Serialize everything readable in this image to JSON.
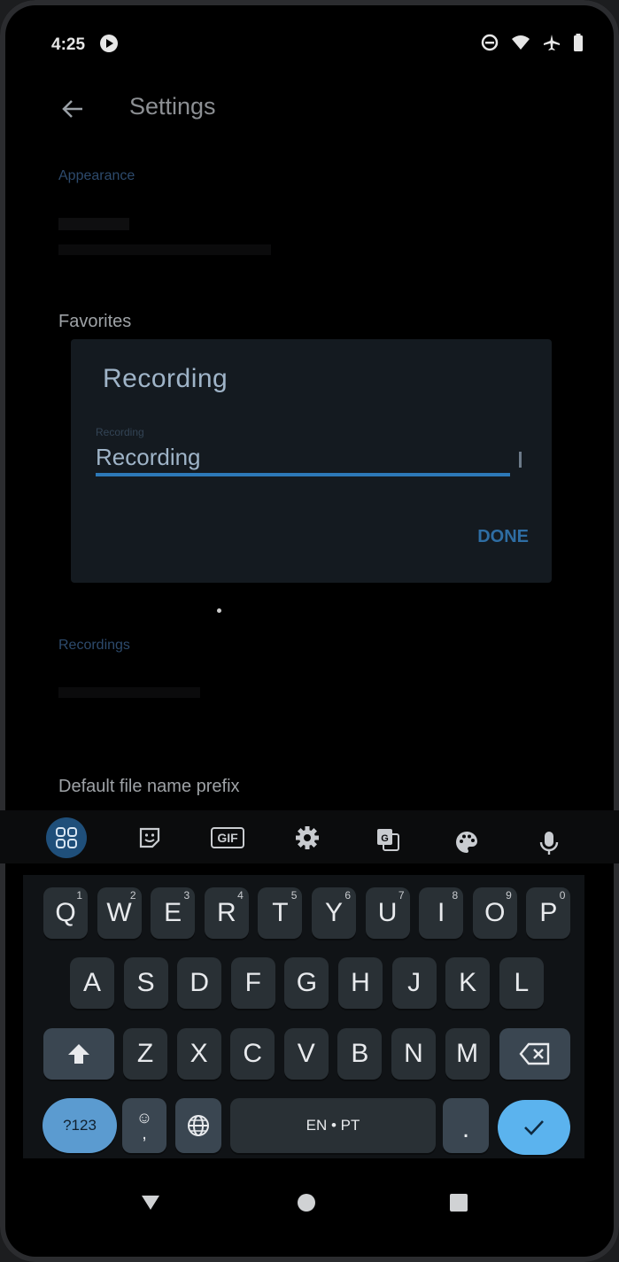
{
  "status_bar": {
    "time": "4:25"
  },
  "app_bar": {
    "title": "Settings"
  },
  "settings": {
    "appearance_header": "Appearance",
    "favorites_label": "Favorites",
    "recordings_header": "Recordings",
    "default_prefix_label": "Default file name prefix"
  },
  "dialog": {
    "title": "Recording",
    "field_label": "Recording",
    "input_value": "Recording",
    "done_label": "DONE"
  },
  "keyboard_toolbar": {
    "icons": [
      "apps-grid-icon",
      "sticker-icon",
      "gif-icon",
      "gear-icon",
      "translate-icon",
      "palette-icon",
      "microphone-icon"
    ],
    "gif_label": "GIF"
  },
  "keyboard": {
    "row1": [
      {
        "letter": "Q",
        "num": "1"
      },
      {
        "letter": "W",
        "num": "2"
      },
      {
        "letter": "E",
        "num": "3"
      },
      {
        "letter": "R",
        "num": "4"
      },
      {
        "letter": "T",
        "num": "5"
      },
      {
        "letter": "Y",
        "num": "6"
      },
      {
        "letter": "U",
        "num": "7"
      },
      {
        "letter": "I",
        "num": "8"
      },
      {
        "letter": "O",
        "num": "9"
      },
      {
        "letter": "P",
        "num": "0"
      }
    ],
    "row2": [
      "A",
      "S",
      "D",
      "F",
      "G",
      "H",
      "J",
      "K",
      "L"
    ],
    "row3": [
      "Z",
      "X",
      "C",
      "V",
      "B",
      "N",
      "M"
    ],
    "symbols_label": "?123",
    "comma_label": ",",
    "space_label": "EN • PT",
    "period_label": "."
  },
  "colors": {
    "accent": "#2d79b8",
    "enter_key": "#5bb3ee",
    "key_bg": "#293035"
  }
}
